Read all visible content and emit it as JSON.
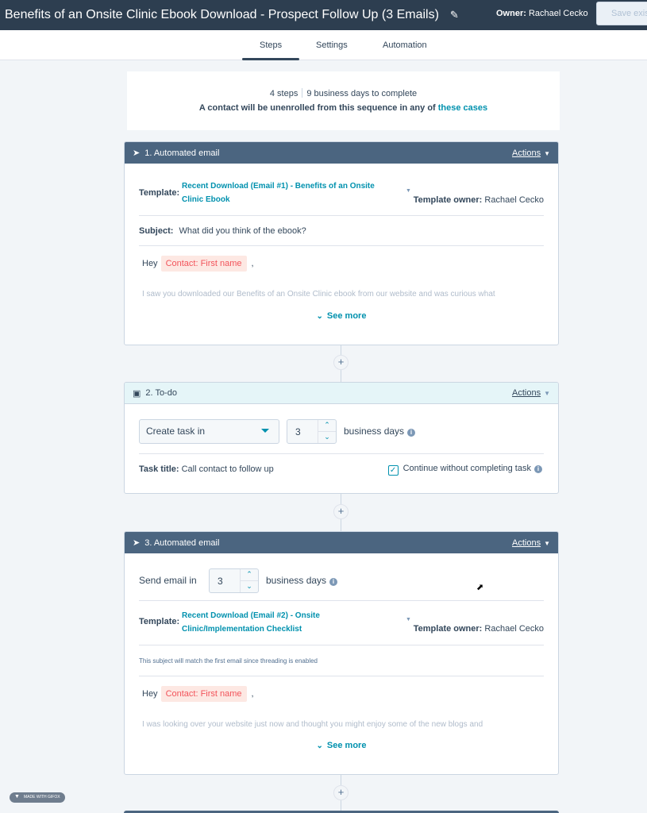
{
  "header": {
    "title": "Benefits of an Onsite Clinic Ebook Download - Prospect Follow Up (3 Emails)",
    "edit_icon": "pencil-icon",
    "owner_label": "Owner:",
    "owner_name": "Rachael Cecko",
    "save_button": "Save exis"
  },
  "tabs": [
    {
      "label": "Steps",
      "active": true
    },
    {
      "label": "Settings",
      "active": false
    },
    {
      "label": "Automation",
      "active": false
    }
  ],
  "summary": {
    "steps": "4 steps",
    "duration": "9 business days to complete",
    "unenroll_text": "A contact will be unenrolled from this sequence in any of",
    "unenroll_link": "these cases"
  },
  "steps": [
    {
      "header": "1. Automated email",
      "icon": "paper-plane-icon",
      "actions": "Actions",
      "template_label": "Template:",
      "template_line1": "Recent Download (Email #1) - Benefits of an Onsite",
      "template_line2": "Clinic Ebook",
      "template_owner_label": "Template owner:",
      "template_owner": "Rachael Cecko",
      "subject_label": "Subject:",
      "subject": "What did you think of the ebook?",
      "greeting": "Hey",
      "token": "Contact: First name",
      "comma": ",",
      "body_preview": "I saw you downloaded our Benefits of an Onsite Clinic ebook from our website and was curious what",
      "see_more": "See more"
    },
    {
      "header": "2. To-do",
      "icon": "task-icon",
      "actions": "Actions",
      "select_value": "Create task in",
      "days_value": "3",
      "days_label": "business days",
      "task_title_label": "Task title:",
      "task_title": "Call contact to follow up",
      "continue_label": "Continue without completing task",
      "continue_checked": true
    },
    {
      "header": "3. Automated email",
      "icon": "paper-plane-icon",
      "actions": "Actions",
      "send_label": "Send email in",
      "days_value": "3",
      "days_label": "business days",
      "template_label": "Template:",
      "template_line1": "Recent Download (Email #2) - Onsite",
      "template_line2": "Clinic/Implementation Checklist",
      "template_owner_label": "Template owner:",
      "template_owner": "Rachael Cecko",
      "thread_note": "This subject will match the first email since threading is enabled",
      "greeting": "Hey",
      "token": "Contact: First name",
      "comma": ",",
      "body_preview": "I was looking over your website just now and thought you might enjoy some of the new blogs and",
      "see_more": "See more"
    }
  ],
  "add_step": "+",
  "badge": "MADE WITH GIFOX",
  "colors": {
    "topbar": "#2d3e50",
    "step_header_email": "#4b6580",
    "step_header_todo": "#e5f5f8",
    "link": "#0091ae",
    "token_bg": "#fde8e3",
    "token_text": "#f2545b"
  }
}
